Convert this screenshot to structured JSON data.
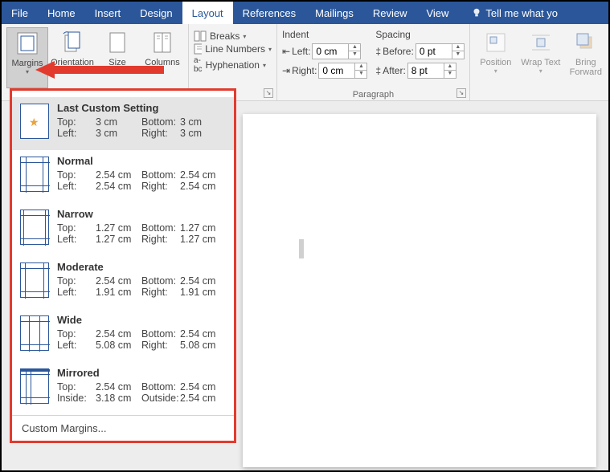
{
  "tabs": [
    "File",
    "Home",
    "Insert",
    "Design",
    "Layout",
    "References",
    "Mailings",
    "Review",
    "View"
  ],
  "tellme": "Tell me what yo",
  "pagesetup": {
    "margins": "Margins",
    "orientation": "Orientation",
    "size": "Size",
    "columns": "Columns",
    "breaks": "Breaks",
    "linenumbers": "Line Numbers",
    "hyphenation": "Hyphenation"
  },
  "paragraph": {
    "label": "Paragraph",
    "indent": "Indent",
    "spacing": "Spacing",
    "left": "Left:",
    "right": "Right:",
    "before": "Before:",
    "after": "After:",
    "left_v": "0 cm",
    "right_v": "0 cm",
    "before_v": "0 pt",
    "after_v": "8 pt"
  },
  "arrange": {
    "position": "Position",
    "wrap": "Wrap Text",
    "bring": "Bring Forward"
  },
  "menu": {
    "items": [
      {
        "title": "Last Custom Setting",
        "k1": "Top:",
        "v1": "3 cm",
        "k2": "Bottom:",
        "v2": "3 cm",
        "k3": "Left:",
        "v3": "3 cm",
        "k4": "Right:",
        "v4": "3 cm",
        "variant": "star"
      },
      {
        "title": "Normal",
        "k1": "Top:",
        "v1": "2.54 cm",
        "k2": "Bottom:",
        "v2": "2.54 cm",
        "k3": "Left:",
        "v3": "2.54 cm",
        "k4": "Right:",
        "v4": "2.54 cm",
        "variant": "normal"
      },
      {
        "title": "Narrow",
        "k1": "Top:",
        "v1": "1.27 cm",
        "k2": "Bottom:",
        "v2": "1.27 cm",
        "k3": "Left:",
        "v3": "1.27 cm",
        "k4": "Right:",
        "v4": "1.27 cm",
        "variant": "narrow"
      },
      {
        "title": "Moderate",
        "k1": "Top:",
        "v1": "2.54 cm",
        "k2": "Bottom:",
        "v2": "2.54 cm",
        "k3": "Left:",
        "v3": "1.91 cm",
        "k4": "Right:",
        "v4": "1.91 cm",
        "variant": "moderate"
      },
      {
        "title": "Wide",
        "k1": "Top:",
        "v1": "2.54 cm",
        "k2": "Bottom:",
        "v2": "2.54 cm",
        "k3": "Left:",
        "v3": "5.08 cm",
        "k4": "Right:",
        "v4": "5.08 cm",
        "variant": "wide"
      },
      {
        "title": "Mirrored",
        "k1": "Top:",
        "v1": "2.54 cm",
        "k2": "Bottom:",
        "v2": "2.54 cm",
        "k3": "Inside:",
        "v3": "3.18 cm",
        "k4": "Outside:",
        "v4": "2.54 cm",
        "variant": "mirrored"
      }
    ],
    "custom": "Custom Margins..."
  }
}
